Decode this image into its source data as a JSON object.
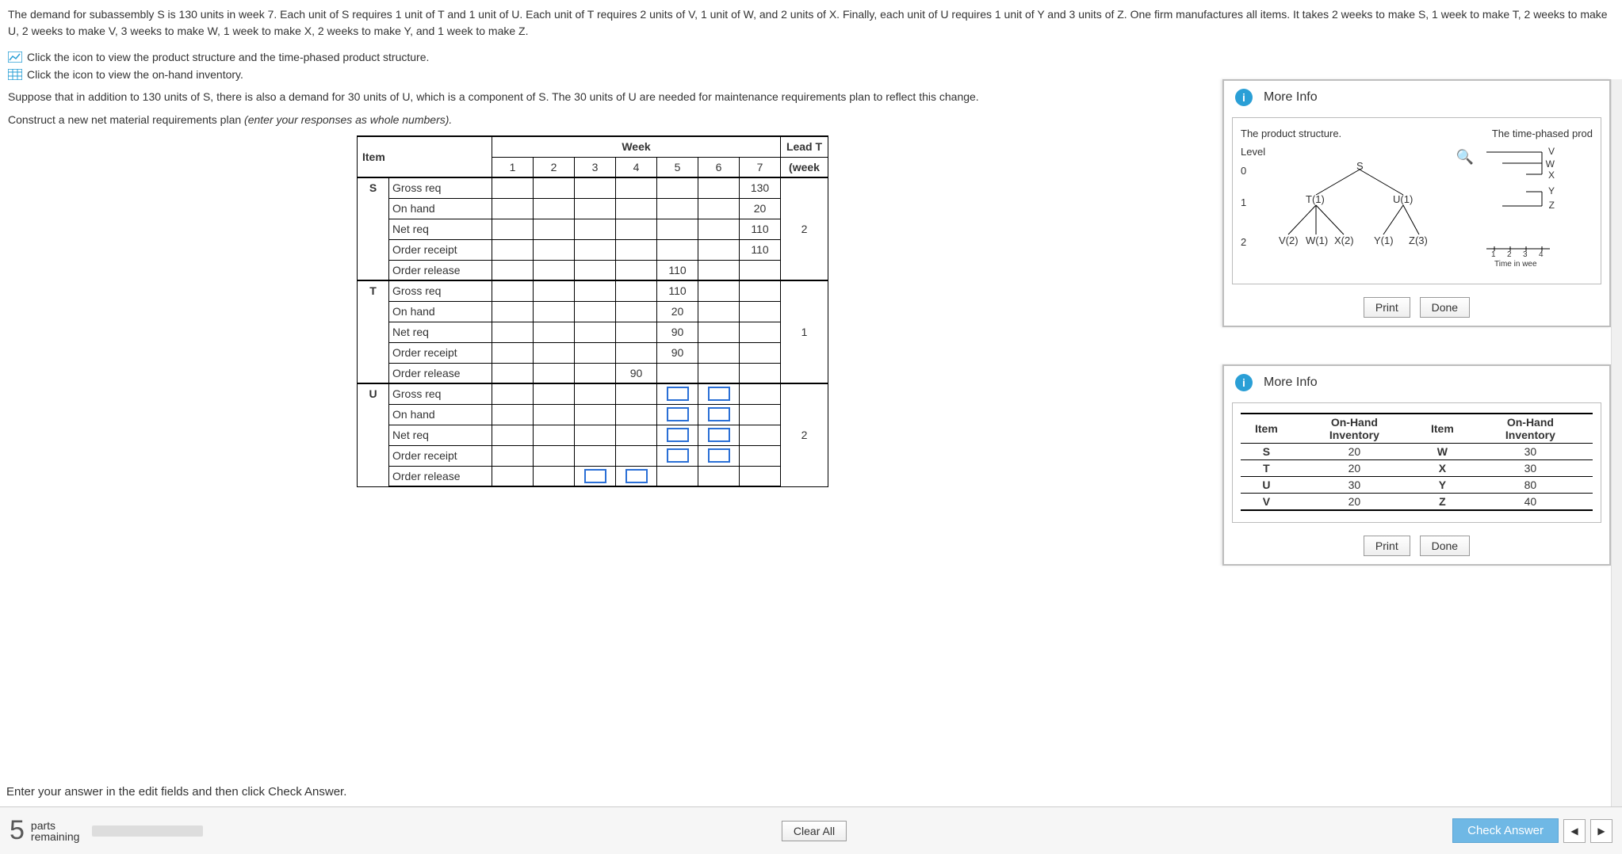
{
  "problem": {
    "paragraph": "The demand for subassembly S is 130 units in week 7. Each unit of S requires 1 unit of T and 1 unit of U. Each unit of T requires 2 units of V, 1 unit of W, and 2 units of X. Finally, each unit of U requires 1 unit of Y and 3 units of Z. One firm manufactures all items. It takes 2 weeks to make S, 1 week to make T, 2 weeks to make U, 2 weeks to make V, 3 weeks to make W, 1 week to make X, 2 weeks to make Y, and 1 week to make Z.",
    "icon_line_structure": "Click the icon to view the product structure and the time-phased product structure.",
    "icon_line_inventory": "Click the icon to view the on-hand inventory.",
    "suppose_line": "Suppose that in addition to 130 units of S, there is also a demand for 30 units of U, which is a component of S. The 30 units of U are needed for maintenance requirements plan to reflect this change.",
    "construct_line": "Construct a new net material requirements plan ",
    "construct_italic": "(enter your responses as whole numbers).",
    "enter_note": "Enter your answer in the edit fields and then click Check Answer."
  },
  "mrp": {
    "headers": {
      "item": "Item",
      "week": "Week",
      "lead": "Lead T",
      "lead2": "(week"
    },
    "weeks": [
      "1",
      "2",
      "3",
      "4",
      "5",
      "6",
      "7"
    ],
    "row_labels": {
      "gross": "Gross req",
      "onhand": "On hand",
      "net": "Net req",
      "receipt": "Order receipt",
      "release": "Order release"
    },
    "items": [
      {
        "id": "S",
        "lead": "2",
        "rows": {
          "gross": [
            "",
            "",
            "",
            "",
            "",
            "",
            "130"
          ],
          "onhand": [
            "",
            "",
            "",
            "",
            "",
            "",
            "20"
          ],
          "net": [
            "",
            "",
            "",
            "",
            "",
            "",
            "110"
          ],
          "receipt": [
            "",
            "",
            "",
            "",
            "",
            "",
            "110"
          ],
          "release": [
            "",
            "",
            "",
            "",
            "110",
            "",
            ""
          ]
        }
      },
      {
        "id": "T",
        "lead": "1",
        "rows": {
          "gross": [
            "",
            "",
            "",
            "",
            "110",
            "",
            ""
          ],
          "onhand": [
            "",
            "",
            "",
            "",
            "20",
            "",
            ""
          ],
          "net": [
            "",
            "",
            "",
            "",
            "90",
            "",
            ""
          ],
          "receipt": [
            "",
            "",
            "",
            "",
            "90",
            "",
            ""
          ],
          "release": [
            "",
            "",
            "",
            "90",
            "",
            "",
            ""
          ]
        }
      },
      {
        "id": "U",
        "lead": "2",
        "rows": {
          "gross": [
            "",
            "",
            "",
            "",
            "[]",
            "[]",
            ""
          ],
          "onhand": [
            "",
            "",
            "",
            "",
            "[]",
            "[]",
            ""
          ],
          "net": [
            "",
            "",
            "",
            "",
            "[]",
            "[]",
            ""
          ],
          "receipt": [
            "",
            "",
            "",
            "",
            "[]",
            "[]",
            ""
          ],
          "release": [
            "",
            "",
            "[]",
            "[]",
            "",
            "",
            ""
          ]
        }
      }
    ]
  },
  "panel1": {
    "title": "More Info",
    "left_title": "The product structure.",
    "right_title": "The time-phased prod",
    "level_label": "Level",
    "levels": [
      "0",
      "1",
      "2"
    ],
    "nodes": {
      "S": "S",
      "T": "T(1)",
      "U": "U(1)",
      "V": "V(2)",
      "W": "W(1)",
      "X": "X(2)",
      "Y": "Y(1)",
      "Z": "Z(3)"
    },
    "right_labels": [
      "V",
      "W",
      "X",
      "Y",
      "Z"
    ],
    "right_axis": "Time in wee",
    "right_ticks": [
      "1",
      "2",
      "3",
      "4"
    ],
    "print": "Print",
    "done": "Done"
  },
  "panel2": {
    "title": "More Info",
    "headers": {
      "item": "Item",
      "inv": "On-Hand Inventory"
    },
    "rows_left": [
      [
        "S",
        "20"
      ],
      [
        "T",
        "20"
      ],
      [
        "U",
        "30"
      ],
      [
        "V",
        "20"
      ]
    ],
    "rows_right": [
      [
        "W",
        "30"
      ],
      [
        "X",
        "30"
      ],
      [
        "Y",
        "80"
      ],
      [
        "Z",
        "40"
      ]
    ],
    "print": "Print",
    "done": "Done"
  },
  "footer": {
    "big": "5",
    "parts": "parts",
    "remaining": "remaining",
    "clear": "Clear All",
    "check": "Check Answer"
  }
}
